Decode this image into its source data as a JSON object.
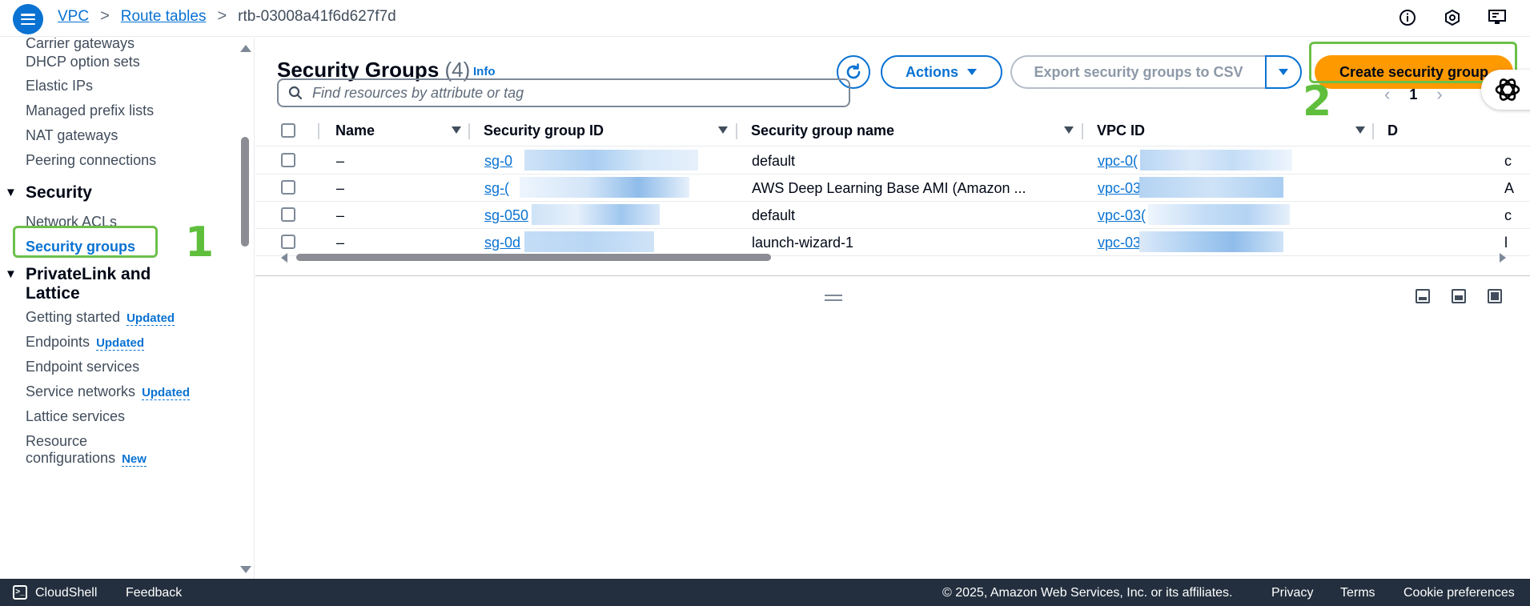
{
  "breadcrumb": {
    "items": [
      "VPC",
      "Route tables"
    ],
    "current": "rtb-03008a41f6d627f7d"
  },
  "sidebar": {
    "items_top": [
      "Carrier gateways",
      "DHCP option sets",
      "Elastic IPs",
      "Managed prefix lists",
      "NAT gateways",
      "Peering connections"
    ],
    "security_section": "Security",
    "security_items": [
      "Network ACLs",
      "Security groups"
    ],
    "privatelink_section_line1": "PrivateLink and",
    "privatelink_section_line2": "Lattice",
    "privatelink_items": [
      {
        "label": "Getting started",
        "badge": "Updated"
      },
      {
        "label": "Endpoints",
        "badge": "Updated"
      },
      {
        "label": "Endpoint services",
        "badge": ""
      },
      {
        "label": "Service networks",
        "badge": "Updated"
      },
      {
        "label": "Lattice services",
        "badge": ""
      },
      {
        "label": "Resource",
        "badge": ""
      },
      {
        "label": "configurations",
        "badge": "New"
      }
    ]
  },
  "annotations": {
    "step1": "1",
    "step2": "2"
  },
  "panel": {
    "title": "Security Groups",
    "count": "(4)",
    "info": "Info",
    "actions_label": "Actions",
    "export_label": "Export security groups to CSV",
    "create_label": "Create security group",
    "search_placeholder": "Find resources by attribute or tag",
    "page": "1"
  },
  "table": {
    "headers": [
      "Name",
      "Security group ID",
      "Security group name",
      "VPC ID",
      "D"
    ],
    "rows": [
      {
        "name": "–",
        "sg_id": "sg-0",
        "sg_name": "default",
        "vpc_id": "vpc-0(",
        "desc": "c"
      },
      {
        "name": "–",
        "sg_id": "sg-(",
        "sg_name": "AWS Deep Learning Base AMI (Amazon ...",
        "vpc_id": "vpc-03",
        "desc": "A"
      },
      {
        "name": "–",
        "sg_id": "sg-050",
        "sg_name": "default",
        "vpc_id": "vpc-03(",
        "desc": "c"
      },
      {
        "name": "–",
        "sg_id": "sg-0d",
        "sg_name": "launch-wizard-1",
        "vpc_id": "vpc-03",
        "desc": "l"
      }
    ]
  },
  "footer": {
    "cloudshell": "CloudShell",
    "feedback": "Feedback",
    "copyright": "© 2025, Amazon Web Services, Inc. or its affiliates.",
    "privacy": "Privacy",
    "terms": "Terms",
    "cookies": "Cookie preferences"
  },
  "colors": {
    "accent": "#0972d3",
    "primary_button": "#ff9900",
    "highlight": "#6cc04a",
    "footer_bg": "#232f3e"
  }
}
